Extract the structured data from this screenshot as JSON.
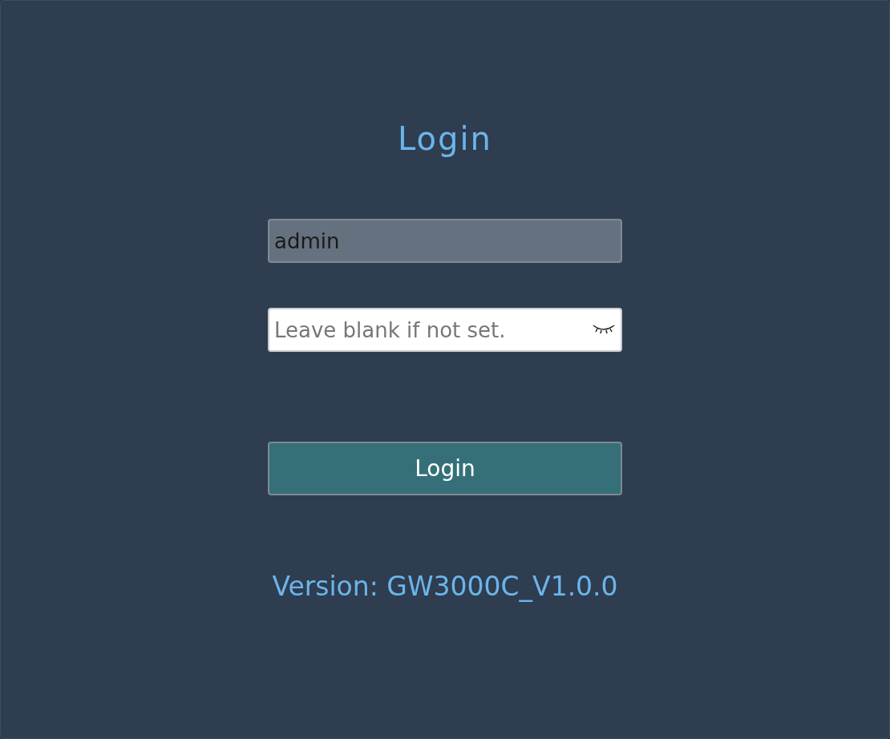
{
  "title": "Login",
  "fields": [
    {
      "kind": "text",
      "value": "admin",
      "disabled": true
    },
    {
      "kind": "password",
      "placeholder": "Leave blank if not set.",
      "disabled": false,
      "password_visible": false
    }
  ],
  "button": "Login",
  "version": "Version: GW3000C_V1.0.0"
}
